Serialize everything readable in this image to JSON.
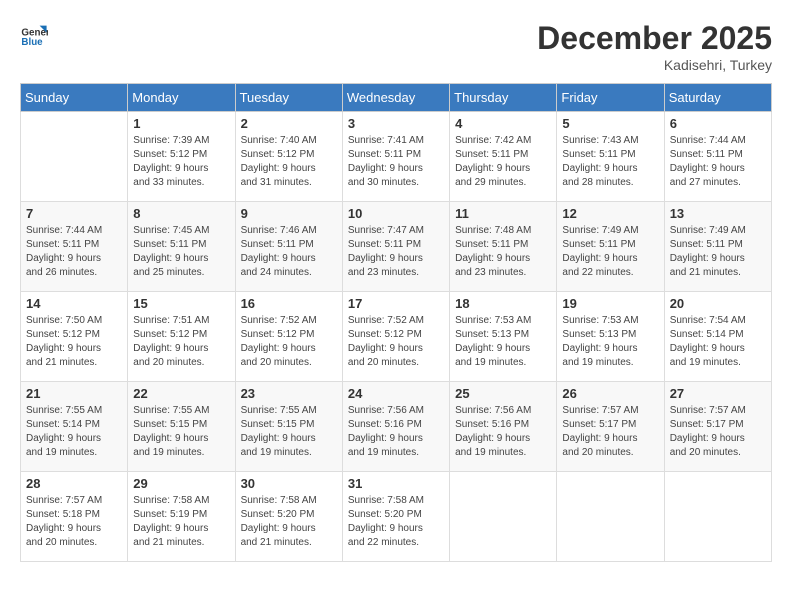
{
  "header": {
    "logo_line1": "General",
    "logo_line2": "Blue",
    "month_year": "December 2025",
    "location": "Kadisehri, Turkey"
  },
  "days_of_week": [
    "Sunday",
    "Monday",
    "Tuesday",
    "Wednesday",
    "Thursday",
    "Friday",
    "Saturday"
  ],
  "weeks": [
    [
      {
        "day": "",
        "info": ""
      },
      {
        "day": "1",
        "info": "Sunrise: 7:39 AM\nSunset: 5:12 PM\nDaylight: 9 hours\nand 33 minutes."
      },
      {
        "day": "2",
        "info": "Sunrise: 7:40 AM\nSunset: 5:12 PM\nDaylight: 9 hours\nand 31 minutes."
      },
      {
        "day": "3",
        "info": "Sunrise: 7:41 AM\nSunset: 5:11 PM\nDaylight: 9 hours\nand 30 minutes."
      },
      {
        "day": "4",
        "info": "Sunrise: 7:42 AM\nSunset: 5:11 PM\nDaylight: 9 hours\nand 29 minutes."
      },
      {
        "day": "5",
        "info": "Sunrise: 7:43 AM\nSunset: 5:11 PM\nDaylight: 9 hours\nand 28 minutes."
      },
      {
        "day": "6",
        "info": "Sunrise: 7:44 AM\nSunset: 5:11 PM\nDaylight: 9 hours\nand 27 minutes."
      }
    ],
    [
      {
        "day": "7",
        "info": "Sunrise: 7:44 AM\nSunset: 5:11 PM\nDaylight: 9 hours\nand 26 minutes."
      },
      {
        "day": "8",
        "info": "Sunrise: 7:45 AM\nSunset: 5:11 PM\nDaylight: 9 hours\nand 25 minutes."
      },
      {
        "day": "9",
        "info": "Sunrise: 7:46 AM\nSunset: 5:11 PM\nDaylight: 9 hours\nand 24 minutes."
      },
      {
        "day": "10",
        "info": "Sunrise: 7:47 AM\nSunset: 5:11 PM\nDaylight: 9 hours\nand 23 minutes."
      },
      {
        "day": "11",
        "info": "Sunrise: 7:48 AM\nSunset: 5:11 PM\nDaylight: 9 hours\nand 23 minutes."
      },
      {
        "day": "12",
        "info": "Sunrise: 7:49 AM\nSunset: 5:11 PM\nDaylight: 9 hours\nand 22 minutes."
      },
      {
        "day": "13",
        "info": "Sunrise: 7:49 AM\nSunset: 5:11 PM\nDaylight: 9 hours\nand 21 minutes."
      }
    ],
    [
      {
        "day": "14",
        "info": "Sunrise: 7:50 AM\nSunset: 5:12 PM\nDaylight: 9 hours\nand 21 minutes."
      },
      {
        "day": "15",
        "info": "Sunrise: 7:51 AM\nSunset: 5:12 PM\nDaylight: 9 hours\nand 20 minutes."
      },
      {
        "day": "16",
        "info": "Sunrise: 7:52 AM\nSunset: 5:12 PM\nDaylight: 9 hours\nand 20 minutes."
      },
      {
        "day": "17",
        "info": "Sunrise: 7:52 AM\nSunset: 5:12 PM\nDaylight: 9 hours\nand 20 minutes."
      },
      {
        "day": "18",
        "info": "Sunrise: 7:53 AM\nSunset: 5:13 PM\nDaylight: 9 hours\nand 19 minutes."
      },
      {
        "day": "19",
        "info": "Sunrise: 7:53 AM\nSunset: 5:13 PM\nDaylight: 9 hours\nand 19 minutes."
      },
      {
        "day": "20",
        "info": "Sunrise: 7:54 AM\nSunset: 5:14 PM\nDaylight: 9 hours\nand 19 minutes."
      }
    ],
    [
      {
        "day": "21",
        "info": "Sunrise: 7:55 AM\nSunset: 5:14 PM\nDaylight: 9 hours\nand 19 minutes."
      },
      {
        "day": "22",
        "info": "Sunrise: 7:55 AM\nSunset: 5:15 PM\nDaylight: 9 hours\nand 19 minutes."
      },
      {
        "day": "23",
        "info": "Sunrise: 7:55 AM\nSunset: 5:15 PM\nDaylight: 9 hours\nand 19 minutes."
      },
      {
        "day": "24",
        "info": "Sunrise: 7:56 AM\nSunset: 5:16 PM\nDaylight: 9 hours\nand 19 minutes."
      },
      {
        "day": "25",
        "info": "Sunrise: 7:56 AM\nSunset: 5:16 PM\nDaylight: 9 hours\nand 19 minutes."
      },
      {
        "day": "26",
        "info": "Sunrise: 7:57 AM\nSunset: 5:17 PM\nDaylight: 9 hours\nand 20 minutes."
      },
      {
        "day": "27",
        "info": "Sunrise: 7:57 AM\nSunset: 5:17 PM\nDaylight: 9 hours\nand 20 minutes."
      }
    ],
    [
      {
        "day": "28",
        "info": "Sunrise: 7:57 AM\nSunset: 5:18 PM\nDaylight: 9 hours\nand 20 minutes."
      },
      {
        "day": "29",
        "info": "Sunrise: 7:58 AM\nSunset: 5:19 PM\nDaylight: 9 hours\nand 21 minutes."
      },
      {
        "day": "30",
        "info": "Sunrise: 7:58 AM\nSunset: 5:20 PM\nDaylight: 9 hours\nand 21 minutes."
      },
      {
        "day": "31",
        "info": "Sunrise: 7:58 AM\nSunset: 5:20 PM\nDaylight: 9 hours\nand 22 minutes."
      },
      {
        "day": "",
        "info": ""
      },
      {
        "day": "",
        "info": ""
      },
      {
        "day": "",
        "info": ""
      }
    ]
  ]
}
